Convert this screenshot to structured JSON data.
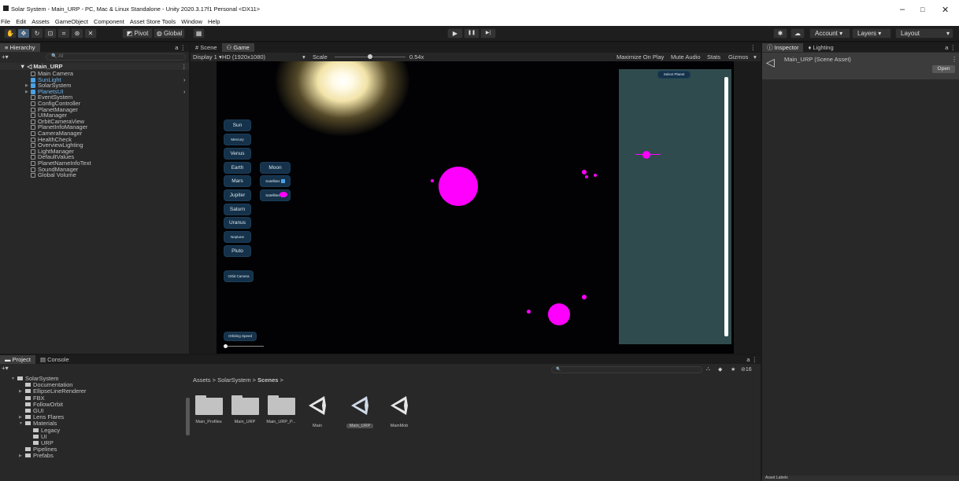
{
  "window": {
    "title": "Solar System - Main_URP - PC, Mac & Linux Standalone - Unity 2020.3.17f1 Personal <DX11>",
    "minimize": "–",
    "maximize": "□",
    "close": "✕"
  },
  "menu": [
    "File",
    "Edit",
    "Assets",
    "GameObject",
    "Component",
    "Asset Store Tools",
    "Window",
    "Help"
  ],
  "toolbar": {
    "pivot": "Pivot",
    "global": "Global",
    "play": "▶",
    "pause": "❚❚",
    "step": "▶|",
    "account": "Account",
    "layers": "Layers",
    "layout": "Layout"
  },
  "hierarchy": {
    "tab": "Hierarchy",
    "search_placeholder": "All",
    "scene": "Main_URP",
    "items": [
      {
        "label": "Main Camera",
        "blue": false
      },
      {
        "label": "SunLight",
        "blue": true
      },
      {
        "label": "SolarSystem",
        "blue": true,
        "text_blue": false
      },
      {
        "label": "PlanetsUI",
        "blue": true
      },
      {
        "label": "EventSystem",
        "blue": false
      },
      {
        "label": "ConfigController",
        "blue": false
      },
      {
        "label": "PlanetManager",
        "blue": false
      },
      {
        "label": "UIManager",
        "blue": false
      },
      {
        "label": "OrbitCameraView",
        "blue": false
      },
      {
        "label": "PlanetInfoManager",
        "blue": false
      },
      {
        "label": "CameraManager",
        "blue": false
      },
      {
        "label": "HealthCheck",
        "blue": false
      },
      {
        "label": "OverviewLighting",
        "blue": false
      },
      {
        "label": "LightManager",
        "blue": false
      },
      {
        "label": "DefaultValues",
        "blue": false
      },
      {
        "label": "PlanetNameInfoText",
        "blue": false
      },
      {
        "label": "SoundManager",
        "blue": false
      },
      {
        "label": "Global Volume",
        "blue": false
      }
    ]
  },
  "game": {
    "tab_scene": "Scene",
    "tab_game": "Game",
    "display": "Display 1",
    "resolution": "HD (1920x1080)",
    "scale_label": "Scale",
    "scale_value": "0.54x",
    "scale_fraction": 0.5,
    "options": [
      "Maximize On Play",
      "Mute Audio",
      "Stats",
      "Gizmos"
    ],
    "planet_buttons": [
      "Sun",
      "Mercury",
      "Venus",
      "Earth",
      "Mars",
      "Jupiter",
      "Saturn",
      "Uranus",
      "Neptune",
      "Pluto"
    ],
    "moon": "Moon",
    "satellites": "Satellites",
    "orbit_camera": "Orbit Camera",
    "orbiting_speed": "Orbiting Speed",
    "select_planet": "Select Planet"
  },
  "inspector": {
    "tab": "Inspector",
    "tab_lighting": "Lighting",
    "asset": "Main_URP (Scene Asset)",
    "open": "Open",
    "bottom_label": "Asset Labels"
  },
  "project": {
    "tab_project": "Project",
    "tab_console": "Console",
    "hidden_count": "16",
    "breadcrumb": [
      "Assets",
      "SolarSystem",
      "Scenes"
    ],
    "tree": [
      {
        "label": "SolarSystem",
        "indent": 0,
        "arrow": "▼"
      },
      {
        "label": "Documentation",
        "indent": 1,
        "arrow": ""
      },
      {
        "label": "EllipseLineRenderer",
        "indent": 1,
        "arrow": "▶"
      },
      {
        "label": "FBX",
        "indent": 1,
        "arrow": ""
      },
      {
        "label": "FollowOrbit",
        "indent": 1,
        "arrow": ""
      },
      {
        "label": "GUI",
        "indent": 1,
        "arrow": ""
      },
      {
        "label": "Lens Flares",
        "indent": 1,
        "arrow": "▶"
      },
      {
        "label": "Materials",
        "indent": 1,
        "arrow": "▼"
      },
      {
        "label": "Legacy",
        "indent": 2,
        "arrow": ""
      },
      {
        "label": "UI",
        "indent": 2,
        "arrow": ""
      },
      {
        "label": "URP",
        "indent": 2,
        "arrow": ""
      },
      {
        "label": "Pipelines",
        "indent": 1,
        "arrow": ""
      },
      {
        "label": "Prefabs",
        "indent": 1,
        "arrow": "▶"
      }
    ],
    "assets": [
      {
        "label": "Main_Profiles",
        "kind": "folder"
      },
      {
        "label": "Main_URP",
        "kind": "folder"
      },
      {
        "label": "Main_URP_P...",
        "kind": "folder"
      },
      {
        "label": "Main",
        "kind": "scene"
      },
      {
        "label": "Main_URP",
        "kind": "scene",
        "selected": true
      },
      {
        "label": "MainMob",
        "kind": "scene"
      }
    ]
  },
  "colors": {
    "accent": "#2c5d87",
    "planet": "#ff00ff",
    "panel": "#2f4b4d"
  }
}
